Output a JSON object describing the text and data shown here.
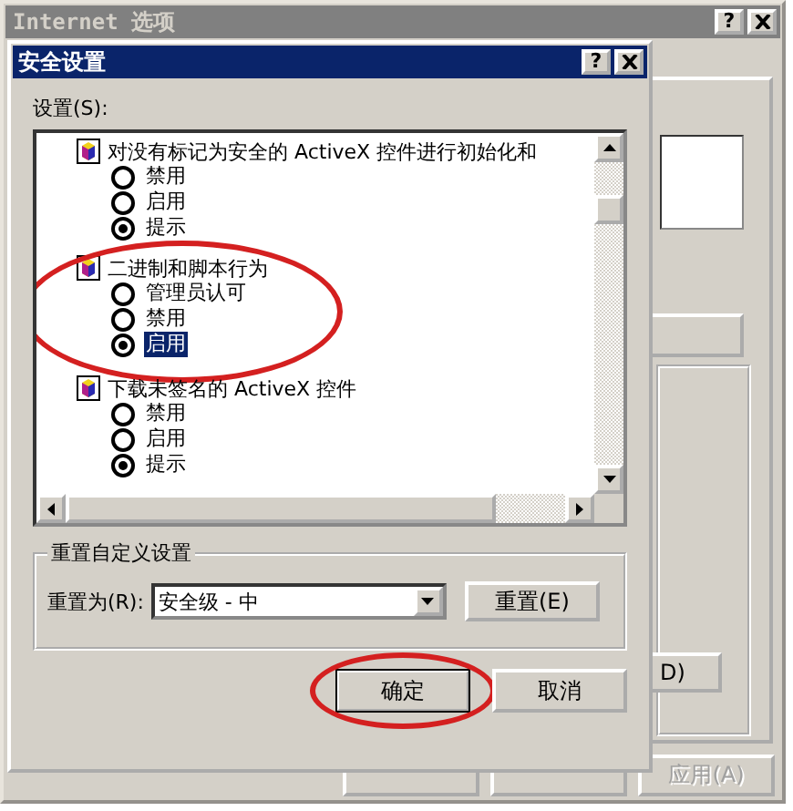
{
  "window": {
    "title": "Internet 选项",
    "help": "?"
  },
  "background": {
    "partial_button": "D)",
    "buttons": [
      {
        "label": "应用(A)",
        "disabled": true
      }
    ]
  },
  "dialog": {
    "title": "安全设置",
    "help": "?",
    "settings_label": "设置(S):",
    "tree": [
      {
        "label": "对没有标记为安全的 ActiveX 控件进行初始化和",
        "circled": false,
        "children": [
          {
            "label": "禁用",
            "selected": false,
            "focused": false
          },
          {
            "label": "启用",
            "selected": false,
            "focused": false
          },
          {
            "label": "提示",
            "selected": true,
            "focused": false
          }
        ]
      },
      {
        "label": "二进制和脚本行为",
        "circled": true,
        "children": [
          {
            "label": "管理员认可",
            "selected": false,
            "focused": false
          },
          {
            "label": "禁用",
            "selected": false,
            "focused": false
          },
          {
            "label": "启用",
            "selected": true,
            "focused": true
          }
        ]
      },
      {
        "label": "下载未签名的 ActiveX 控件",
        "circled": false,
        "children": [
          {
            "label": "禁用",
            "selected": false,
            "focused": false
          },
          {
            "label": "启用",
            "selected": false,
            "focused": false
          },
          {
            "label": "提示",
            "selected": true,
            "focused": false
          }
        ]
      }
    ],
    "reset_group": {
      "title": "重置自定义设置",
      "label": "重置为(R):",
      "value": "安全级 - 中",
      "button": "重置(E)"
    },
    "buttons": [
      {
        "label": "确定",
        "default": true,
        "circled": true
      },
      {
        "label": "取消",
        "default": false,
        "circled": false
      }
    ]
  }
}
